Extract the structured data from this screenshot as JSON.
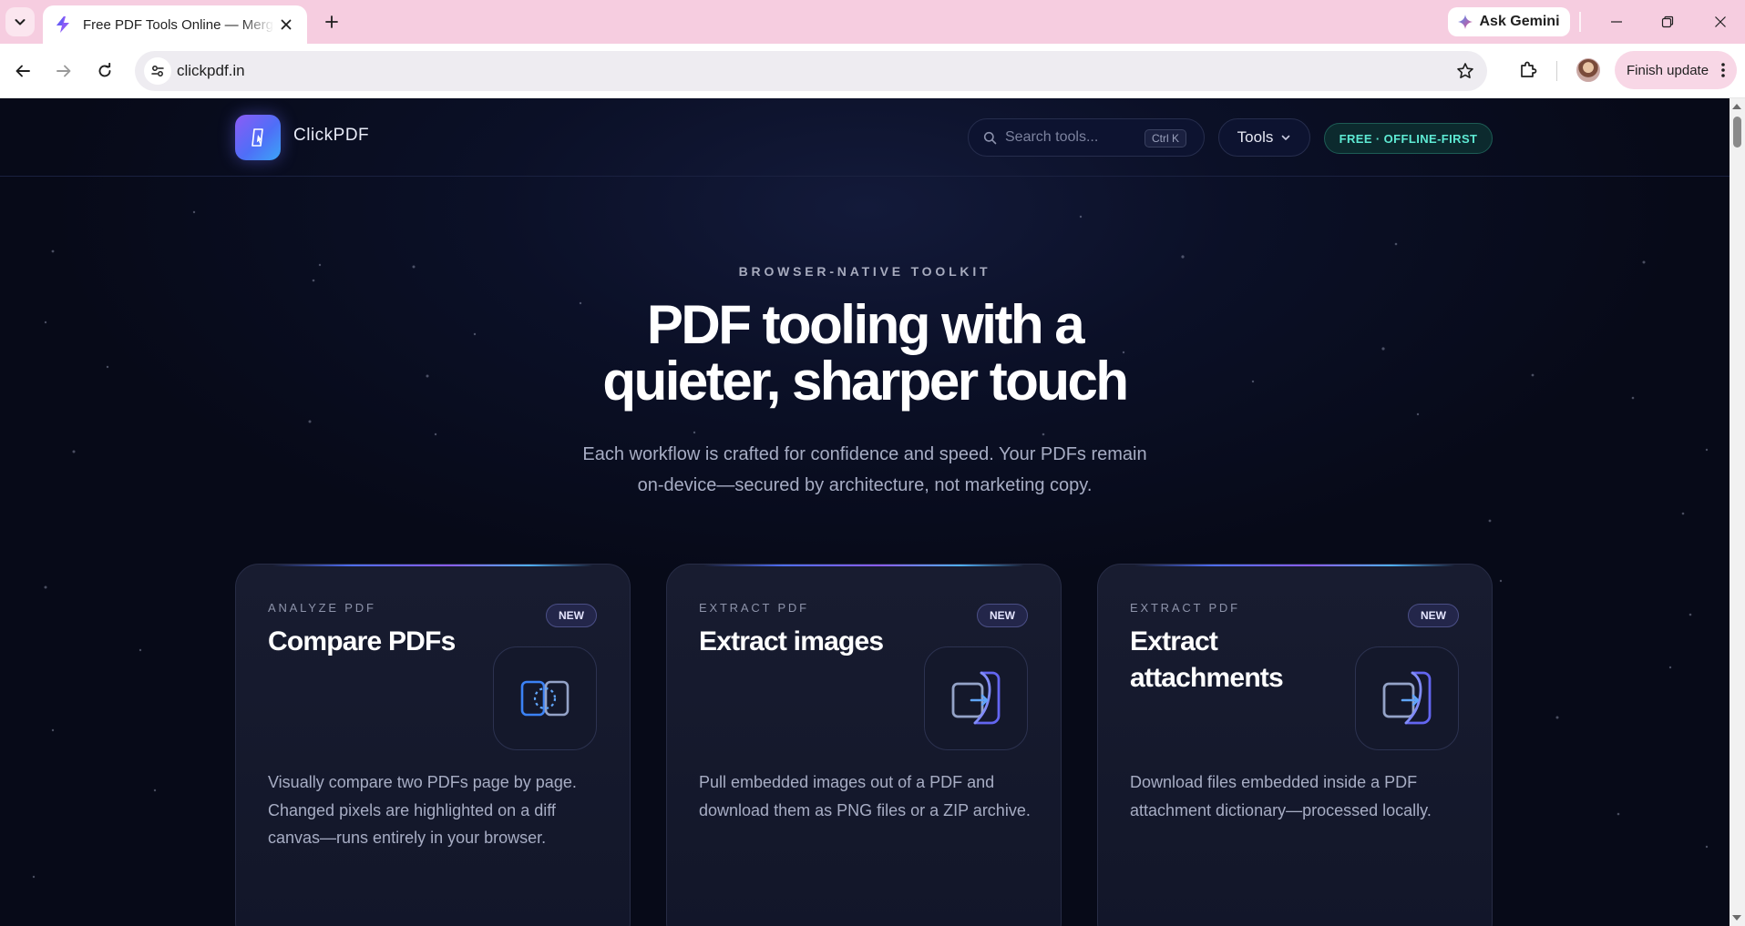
{
  "browser": {
    "tab_title": "Free PDF Tools Online — Merge",
    "ask_gemini_label": "Ask Gemini",
    "url": "clickpdf.in",
    "finish_update_label": "Finish update"
  },
  "site": {
    "brand": "ClickPDF",
    "search_placeholder": "Search tools...",
    "search_shortcut": "Ctrl K",
    "tools_label": "Tools",
    "badge": "FREE · OFFLINE-FIRST"
  },
  "hero": {
    "eyebrow": "BROWSER-NATIVE TOOLKIT",
    "title_line1": "PDF tooling with a",
    "title_line2": "quieter, sharper touch",
    "subtitle_line1": "Each workflow is crafted for confidence and speed. Your PDFs remain",
    "subtitle_line2": "on-device—secured by architecture, not marketing copy."
  },
  "cards": [
    {
      "eyebrow": "ANALYZE PDF",
      "title": "Compare PDFs",
      "badge": "NEW",
      "icon": "compare-icon",
      "description": "Visually compare two PDFs page by page. Changed pixels are highlighted on a diff canvas—runs entirely in your browser."
    },
    {
      "eyebrow": "EXTRACT PDF",
      "title": "Extract images",
      "badge": "NEW",
      "icon": "extract-icon",
      "description": "Pull embedded images out of a PDF and download them as PNG files or a ZIP archive."
    },
    {
      "eyebrow": "EXTRACT PDF",
      "title": "Extract attachments",
      "badge": "NEW",
      "icon": "extract-icon",
      "description": "Download files embedded inside a PDF attachment dictionary—processed locally."
    }
  ],
  "colors": {
    "page_background": "#070a18",
    "accent": "#4f6ef7",
    "accent_secondary": "#8b5cf6",
    "badge_teal": "#5eead4",
    "tab_strip": "#f6cde0"
  }
}
